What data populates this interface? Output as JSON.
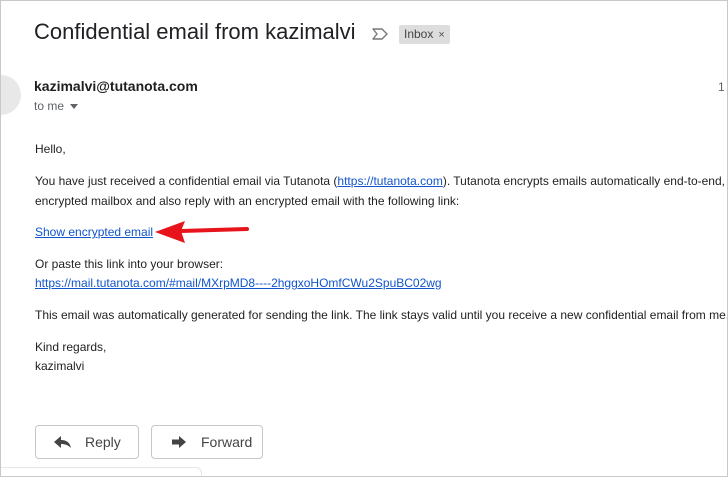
{
  "email": {
    "subject": "Confidential email from kazimalvi",
    "label": "Inbox",
    "label_remove": "×",
    "sender": "kazimalvi@tutanota.com",
    "recipient": "to me",
    "date_fragment": "1",
    "body": {
      "greeting": "Hello,",
      "intro_before_link": "You have just received a confidential email via Tutanota (",
      "tutanota_link": "https://tutanota.com",
      "intro_after_link": "). Tutanota encrypts emails automatically end-to-end,",
      "intro_line2": "encrypted mailbox and also reply with an encrypted email with the following link:",
      "show_link": "Show encrypted email",
      "paste_prompt": "Or paste this link into your browser:",
      "mail_link": "https://mail.tutanota.com/#mail/MXrpMD8----2hggxoHOmfCWu2SpuBC02wg",
      "auto_note": "This email was automatically generated for sending the link. The link stays valid until you receive a new confidential email from me.",
      "closing": "Kind regards,",
      "signature": "kazimalvi"
    }
  },
  "actions": {
    "reply_label": "Reply",
    "forward_label": "Forward"
  },
  "colors": {
    "link": "#1155cc",
    "annotation_arrow": "#e8141b"
  }
}
